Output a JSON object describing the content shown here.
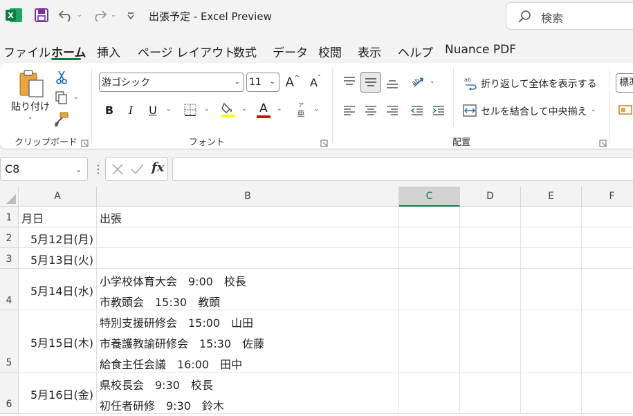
{
  "titlebar": {
    "app_icon": "excel-logo",
    "title": "出張予定  -  Excel Preview",
    "search_placeholder": "検索"
  },
  "tabs": [
    "ファイル",
    "ホーム",
    "挿入",
    "ページ レイアウト",
    "数式",
    "データ",
    "校閲",
    "表示",
    "ヘルプ",
    "Nuance PDF"
  ],
  "active_tab": "ホーム",
  "ribbon": {
    "clipboard": {
      "paste_label": "貼り付け",
      "group_label": "クリップボード"
    },
    "font": {
      "font_name": "游ゴシック",
      "font_size": "11",
      "grow_label": "A",
      "shrink_label": "A",
      "bold": "B",
      "italic": "I",
      "underline": "U",
      "font_color_glyph": "A",
      "phonetic_top": "ア",
      "phonetic_bottom": "亜",
      "group_label": "フォント",
      "highlight_color": "#ffff00",
      "font_color": "#e00000"
    },
    "alignment": {
      "wrap_text": "折り返して全体を表示する",
      "merge_center": "セルを結合して中央揃え",
      "group_label": "配置"
    },
    "styles": {
      "style_box": "標準"
    }
  },
  "formula_bar": {
    "name_box": "C8",
    "fx": "fx",
    "formula": ""
  },
  "grid": {
    "columns": [
      "A",
      "B",
      "C",
      "D",
      "E",
      "F"
    ],
    "selected_column": "C",
    "rows": [
      {
        "num": "1",
        "a": "月日",
        "b": [
          "出張"
        ]
      },
      {
        "num": "2",
        "a": "5月12日(月)",
        "b": []
      },
      {
        "num": "3",
        "a": "5月13日(火)",
        "b": []
      },
      {
        "num": "4",
        "a": "5月14日(水)",
        "b": [
          "小学校体育大会　9:00　校長",
          "市教頭会　15:30　教頭"
        ]
      },
      {
        "num": "5",
        "a": "5月15日(木)",
        "b": [
          "特別支援研修会　15:00　山田",
          "市養護教諭研修会　15:30　佐藤",
          "給食主任会議　16:00　田中"
        ]
      },
      {
        "num": "6",
        "a": "5月16日(金)",
        "b": [
          "県校長会　9:30　校長",
          "初任者研修　9:30　鈴木"
        ]
      }
    ]
  },
  "colors": {
    "accent": "#107c41",
    "excel_green": "#21a366",
    "save_purple": "#7a2fa0"
  }
}
